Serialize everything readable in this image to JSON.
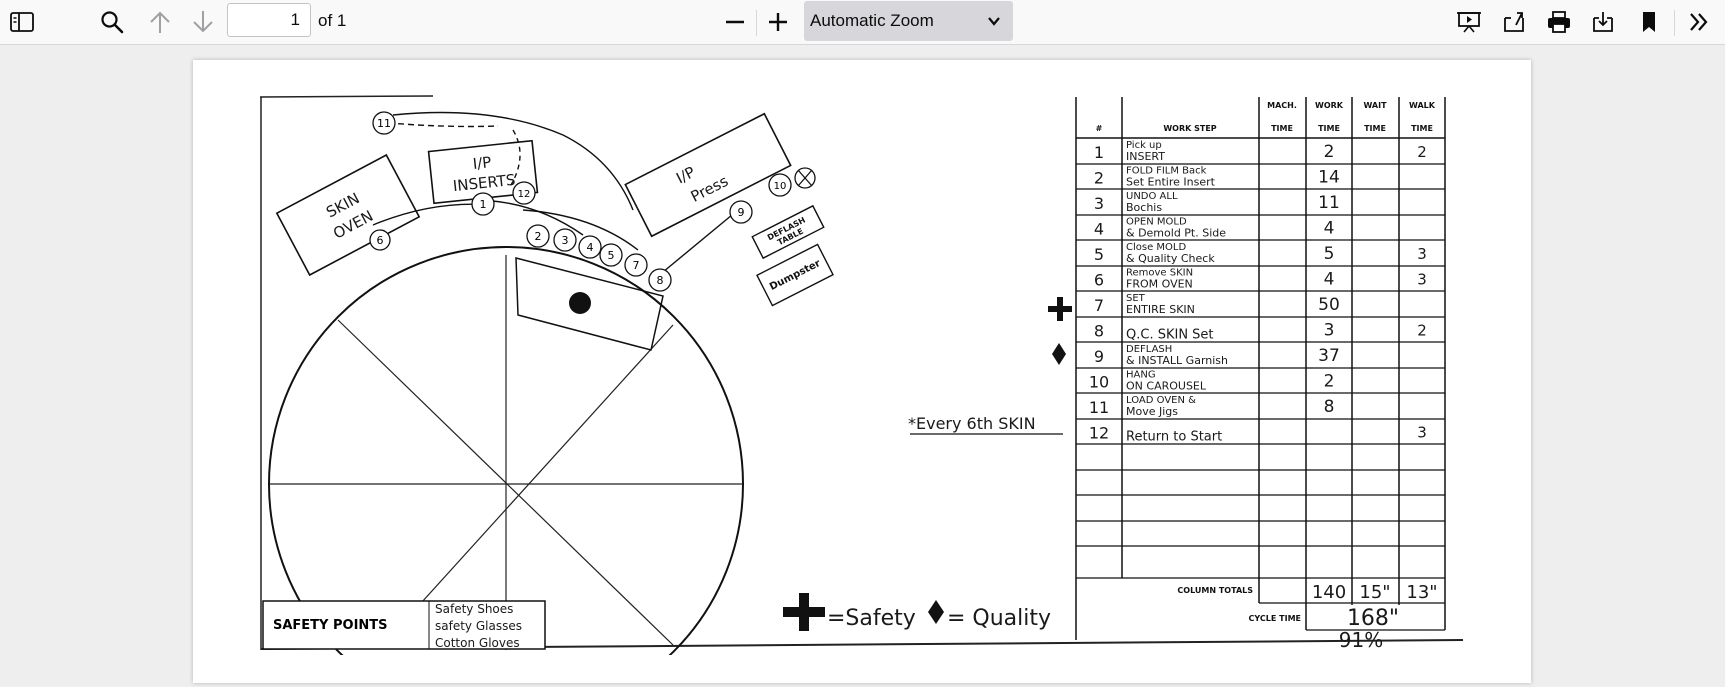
{
  "toolbar": {
    "sidebar_icon": "sidebar-toggle-icon",
    "find_icon": "search-icon",
    "prev_icon": "arrow-up-icon",
    "next_icon": "arrow-down-icon",
    "page_number": "1",
    "page_count": "of 1",
    "zoom_out_icon": "minus-icon",
    "zoom_in_icon": "plus-icon",
    "zoom_value": "Automatic Zoom",
    "presentation_icon": "presentation-icon",
    "open_icon": "open-file-icon",
    "print_icon": "printer-icon",
    "save_icon": "download-icon",
    "bookmark_icon": "bookmark-icon",
    "tools_icon": "double-chevron-right-icon"
  },
  "document": {
    "diagram": {
      "skin_oven": [
        "SKIN",
        "OVEN"
      ],
      "ip_inserts": [
        "I/P",
        "INSERTS"
      ],
      "ip_press": [
        "I/P",
        "Press"
      ],
      "deflash_table": [
        "DEFLASH",
        "TABLE"
      ],
      "dumpster": "Dumpster",
      "safety_points_label": "SAFETY POINTS",
      "safety_points": [
        "Safety Shoes",
        "safety Glasses",
        "Cotton Gloves"
      ],
      "every_note": "*Every 6th SKIN",
      "legend_safety": "=Safety",
      "legend_quality": "= Quality",
      "step_markers": [
        "1",
        "2",
        "3",
        "4",
        "5",
        "6",
        "7",
        "8",
        "9",
        "10",
        "11",
        "12"
      ]
    },
    "table": {
      "headers": {
        "num": "#",
        "step": "WORK STEP",
        "mach": [
          "MACH.",
          "TIME"
        ],
        "work": [
          "WORK",
          "TIME"
        ],
        "wait": [
          "WAIT",
          "TIME"
        ],
        "walk": [
          "WALK",
          "TIME"
        ]
      },
      "rows": [
        {
          "n": "1",
          "a": "Pick up",
          "b": "INSERT",
          "work": "2",
          "walk": "2"
        },
        {
          "n": "2",
          "a": "FOLD FILM Back",
          "b": "Set Entire Insert",
          "work": "14",
          "walk": ""
        },
        {
          "n": "3",
          "a": "UNDO ALL",
          "b": "Bochis",
          "work": "11",
          "walk": ""
        },
        {
          "n": "4",
          "a": "OPEN MOLD",
          "b": "& Demold Pt. Side",
          "work": "4",
          "walk": ""
        },
        {
          "n": "5",
          "a": "Close MOLD",
          "b": "& Quality Check",
          "work": "5",
          "walk": "3"
        },
        {
          "n": "6",
          "a": "Remove SKIN",
          "b": "FROM OVEN",
          "work": "4",
          "walk": "3"
        },
        {
          "n": "7",
          "a": "SET",
          "b": "ENTIRE SKIN",
          "work": "50",
          "walk": ""
        },
        {
          "n": "8",
          "a": "",
          "b": "Q.C. SKIN Set",
          "work": "3",
          "walk": "2"
        },
        {
          "n": "9",
          "a": "DEFLASH",
          "b": "& INSTALL Garnish",
          "work": "37",
          "walk": ""
        },
        {
          "n": "10",
          "a": "HANG",
          "b": "ON CAROUSEL",
          "work": "2",
          "walk": ""
        },
        {
          "n": "11",
          "a": "LOAD OVEN &",
          "b": "Move Jigs",
          "work": "8",
          "walk": ""
        },
        {
          "n": "12",
          "a": "",
          "b": "Return to Start",
          "work": "",
          "walk": "3"
        }
      ],
      "column_totals_label": "COLUMN TOTALS",
      "totals": {
        "work": "140",
        "wait": "15\"",
        "walk": "13\""
      },
      "cycle_time_label": "CYCLE TIME",
      "cycle_time": "168\"",
      "percent": "91%"
    }
  }
}
